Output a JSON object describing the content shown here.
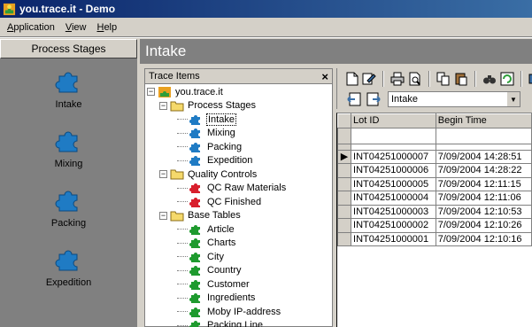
{
  "window": {
    "title": "you.trace.it - Demo"
  },
  "menu": [
    {
      "label": "Application",
      "key": "A",
      "rest": "pplication"
    },
    {
      "label": "View",
      "key": "V",
      "rest": "iew"
    },
    {
      "label": "Help",
      "key": "H",
      "rest": "elp"
    }
  ],
  "sidebar": {
    "header": "Process Stages",
    "items": [
      {
        "label": "Intake",
        "icon": "blue-puzzle-icon"
      },
      {
        "label": "Mixing",
        "icon": "blue-puzzle-icon"
      },
      {
        "label": "Packing",
        "icon": "blue-puzzle-icon"
      },
      {
        "label": "Expedition",
        "icon": "blue-puzzle-icon"
      }
    ]
  },
  "content": {
    "title": "Intake"
  },
  "tree_panel": {
    "title": "Trace Items",
    "close": "×",
    "nodes": [
      {
        "label": "you.trace.it",
        "level": 0,
        "expander": "−",
        "icon": "app",
        "selected": false
      },
      {
        "label": "Process Stages",
        "level": 1,
        "expander": "−",
        "icon": "folder",
        "selected": false
      },
      {
        "label": "Intake",
        "level": 2,
        "icon": "puzzle",
        "color": "#1f7bc4",
        "selected": true
      },
      {
        "label": "Mixing",
        "level": 2,
        "icon": "puzzle",
        "color": "#1f7bc4",
        "selected": false
      },
      {
        "label": "Packing",
        "level": 2,
        "icon": "puzzle",
        "color": "#1f7bc4",
        "selected": false
      },
      {
        "label": "Expedition",
        "level": 2,
        "icon": "puzzle",
        "color": "#1f7bc4",
        "selected": false
      },
      {
        "label": "Quality Controls",
        "level": 1,
        "expander": "−",
        "icon": "folder",
        "selected": false
      },
      {
        "label": "QC Raw Materials",
        "level": 2,
        "icon": "puzzle",
        "color": "#d81f2c",
        "selected": false
      },
      {
        "label": "QC Finished",
        "level": 2,
        "icon": "puzzle",
        "color": "#d81f2c",
        "selected": false
      },
      {
        "label": "Base Tables",
        "level": 1,
        "expander": "−",
        "icon": "folder",
        "selected": false
      },
      {
        "label": "Article",
        "level": 2,
        "icon": "puzzle",
        "color": "#1e9a2e",
        "selected": false
      },
      {
        "label": "Charts",
        "level": 2,
        "icon": "puzzle",
        "color": "#1e9a2e",
        "selected": false
      },
      {
        "label": "City",
        "level": 2,
        "icon": "puzzle",
        "color": "#1e9a2e",
        "selected": false
      },
      {
        "label": "Country",
        "level": 2,
        "icon": "puzzle",
        "color": "#1e9a2e",
        "selected": false
      },
      {
        "label": "Customer",
        "level": 2,
        "icon": "puzzle",
        "color": "#1e9a2e",
        "selected": false
      },
      {
        "label": "Ingredients",
        "level": 2,
        "icon": "puzzle",
        "color": "#1e9a2e",
        "selected": false
      },
      {
        "label": "Moby IP-address",
        "level": 2,
        "icon": "puzzle",
        "color": "#1e9a2e",
        "selected": false
      },
      {
        "label": "Packing Line",
        "level": 2,
        "icon": "puzzle",
        "color": "#1e9a2e",
        "selected": false
      }
    ]
  },
  "grid_panel": {
    "toolbar_icons": [
      "new-icon",
      "edit-icon",
      "print-icon",
      "print-preview-icon",
      "copy-icon",
      "paste-icon",
      "find-icon",
      "refresh-icon",
      "export-icon"
    ],
    "combo": {
      "value": "Intake"
    },
    "columns": [
      "Lot ID",
      "Begin Time"
    ],
    "rows": [
      {
        "lot": "INT04251000007",
        "time": "7/09/2004 14:28:51",
        "current": true
      },
      {
        "lot": "INT04251000006",
        "time": "7/09/2004 14:28:22",
        "current": false
      },
      {
        "lot": "INT04251000005",
        "time": "7/09/2004 12:11:15",
        "current": false
      },
      {
        "lot": "INT04251000004",
        "time": "7/09/2004 12:11:06",
        "current": false
      },
      {
        "lot": "INT04251000003",
        "time": "7/09/2004 12:10:53",
        "current": false
      },
      {
        "lot": "INT04251000002",
        "time": "7/09/2004 12:10:26",
        "current": false
      },
      {
        "lot": "INT04251000001",
        "time": "7/09/2004 12:10:16",
        "current": false
      }
    ]
  },
  "colors": {
    "titlebar": "#0a246a",
    "panel_gray": "#808080",
    "face": "#d4d0c8",
    "puzzle_blue": "#1f7bc4",
    "puzzle_red": "#d81f2c",
    "puzzle_green": "#1e9a2e"
  }
}
